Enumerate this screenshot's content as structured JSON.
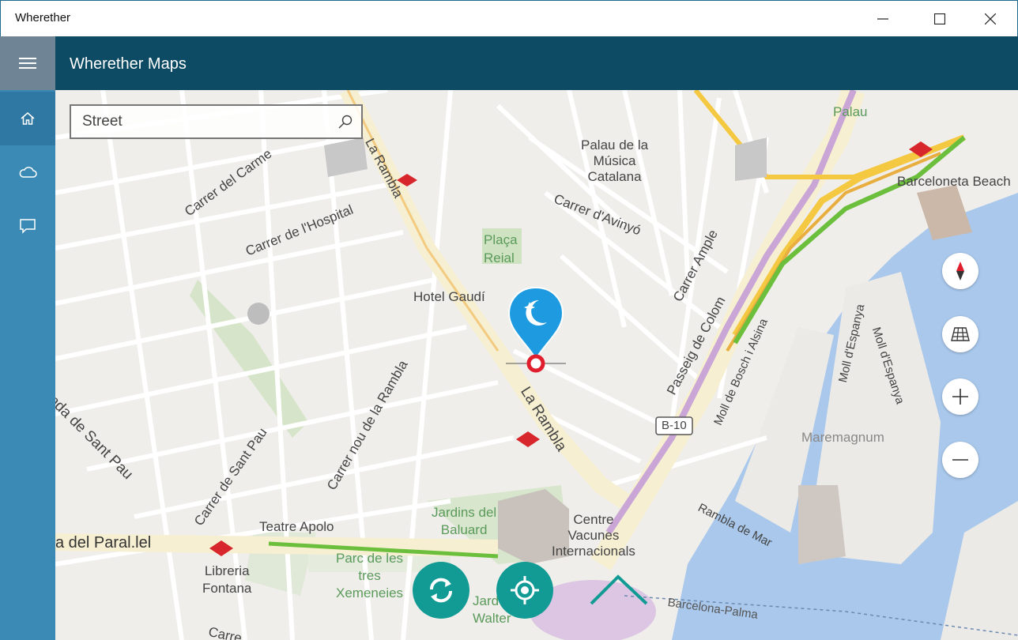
{
  "window": {
    "title": "Wherether"
  },
  "app": {
    "title": "Wherether Maps"
  },
  "nav": {
    "items": [
      {
        "name": "home",
        "icon": "home-icon",
        "active": true
      },
      {
        "name": "weather",
        "icon": "cloud-icon",
        "active": false
      },
      {
        "name": "feedback",
        "icon": "message-icon",
        "active": false
      }
    ]
  },
  "search": {
    "placeholder": "Street",
    "value": ""
  },
  "map": {
    "labels": {
      "la_rambla_top": "La Rambla",
      "carrer_del_carme": "Carrer del Carme",
      "carrer_hospital": "Carrer de l'Hospital",
      "placa_reial": "Plaça\nReial",
      "hotel_gaudi": "Hotel Gaudí",
      "palau_musica": "Palau de la\nMúsica\nCatalana",
      "carrer_avinyo": "Carrer d'Avinyó",
      "carrer_ample": "Carrer Ample",
      "palau": "Palau",
      "barceloneta_beach": "Barceloneta Beach",
      "passeig_colom": "Passeig de Colom",
      "moll_bosch": "Moll de Bosch i Alsina",
      "moll_espanya_1": "Moll d'Espanya",
      "moll_espanya_2": "Moll d'Espanya",
      "maremagnum": "Maremagnum",
      "b10": "B-10",
      "la_rambla_mid": "La Rambla",
      "carrer_nou_rambla": "Carrer nou de la Rambla",
      "ronda_sant_pau": "nda de Sant Pau",
      "carrer_sant_pau": "Carrer de Sant Pau",
      "teatre_apolo": "Teatre Apolo",
      "paral_lel": "a del Paral.lel",
      "jardins_baluard": "Jardins del\nBaluard",
      "centre_vacunes": "Centre\nVacunes\nInternacionals",
      "rambla_mar": "Rambla de Mar",
      "libreria_fontana": "Libreria\nFontana",
      "parc_tres_xemeneies": "Parc de les\ntres\nXemeneies",
      "jardins_walter": "Jard\nWalter",
      "carrer_bottom": "Carre",
      "barcelona_palma": "Barcelona-Palma"
    }
  },
  "controls": {
    "compass": "compass-icon",
    "map_style": "map-style-icon",
    "zoom_in": "plus-icon",
    "zoom_out": "minus-icon",
    "refresh": "refresh-icon",
    "locate": "locate-icon"
  },
  "colors": {
    "accent": "#0d4a63",
    "nav": "#3b8ab5",
    "fab": "#129b94",
    "pin": "#1e9be0",
    "water": "#a9c8ec"
  }
}
